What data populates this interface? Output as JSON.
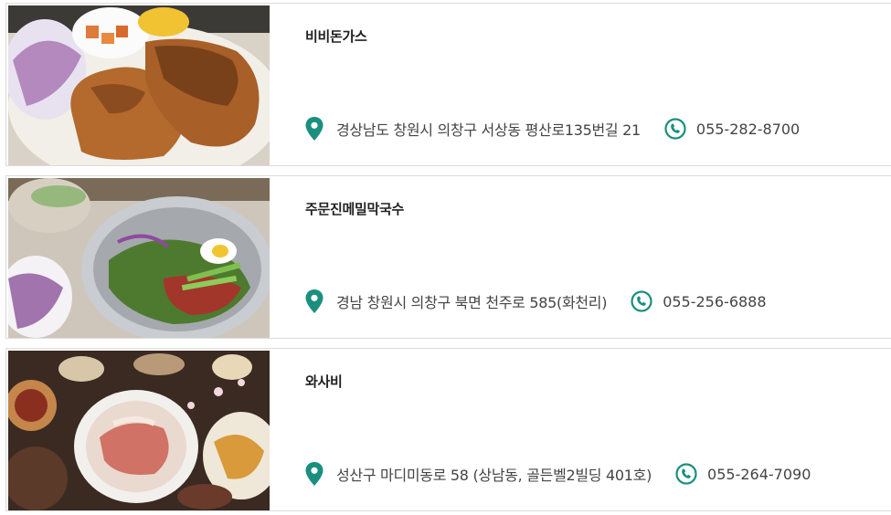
{
  "accent_color": "#1a8f7d",
  "restaurants": [
    {
      "name": "비비돈가스",
      "address": "경상남도 창원시 의창구 서상동 평산로135번길 21",
      "phone": "055-282-8700",
      "image_icon": "pork-cutlet-photo"
    },
    {
      "name": "주문진메밀막국수",
      "address": "경남 창원시 의창구 북면 천주로 585(화천리)",
      "phone": "055-256-6888",
      "image_icon": "buckwheat-noodle-photo"
    },
    {
      "name": "와사비",
      "address": "성산구 마디미동로 58 (상남동, 골든벨2빌딩 401호)",
      "phone": "055-264-7090",
      "image_icon": "sashimi-platter-photo"
    }
  ]
}
